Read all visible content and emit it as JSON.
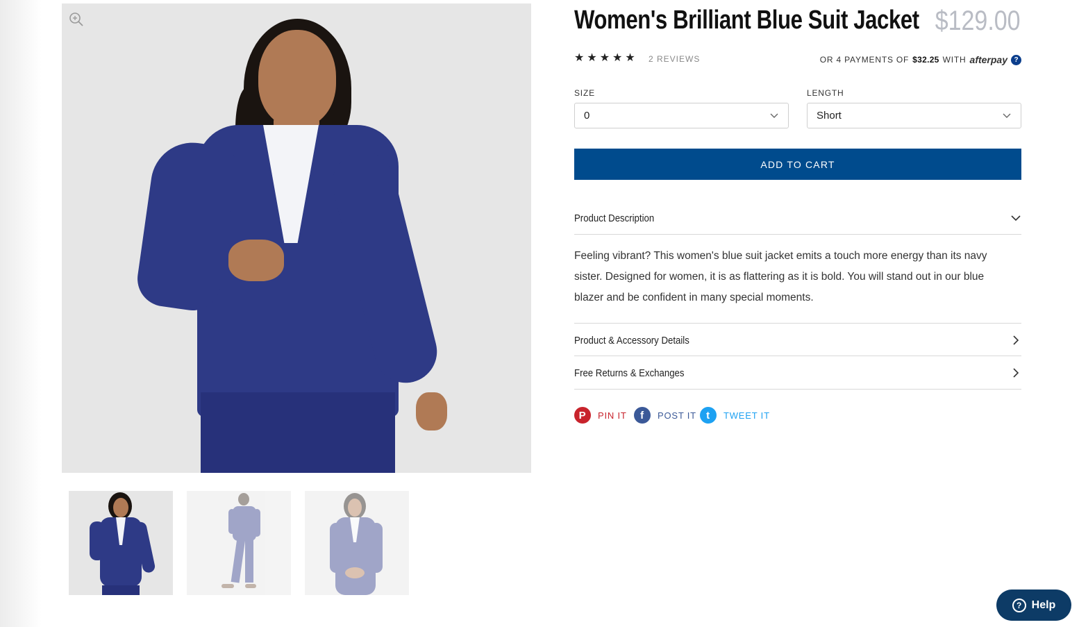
{
  "product": {
    "title": "Women's Brilliant Blue Suit Jacket",
    "price": "$129.00",
    "rating": 5,
    "reviews_label": "2 REVIEWS"
  },
  "afterpay": {
    "prefix": "OR 4 PAYMENTS OF",
    "amount": "$32.25",
    "with": "WITH",
    "logo": "afterpay",
    "help": "?"
  },
  "options": {
    "size_label": "SIZE",
    "size_value": "0",
    "length_label": "LENGTH",
    "length_value": "Short"
  },
  "cart": {
    "add_label": "ADD TO CART"
  },
  "accordion": {
    "description_title": "Product Description",
    "description_text": "Feeling vibrant? This women's blue suit jacket emits a touch more energy than its navy sister. Designed for women, it is as flattering as it is bold. You will stand out in our blue blazer and be confident in many special moments.",
    "details_title": "Product & Accessory Details",
    "returns_title": "Free Returns & Exchanges"
  },
  "share": {
    "pin": "PIN IT",
    "post": "POST IT",
    "tweet": "TWEET IT"
  },
  "help_widget": {
    "label": "Help"
  },
  "colors": {
    "brand_blue": "#004b8d",
    "pinterest": "#c8232c",
    "facebook": "#3b5998",
    "twitter": "#1da1f2",
    "price_gray": "#b9bcc4"
  },
  "icons": [
    "zoom-in-icon",
    "star-icon",
    "chevron-down-icon",
    "chevron-right-icon",
    "pinterest-icon",
    "facebook-icon",
    "twitter-icon",
    "help-icon"
  ]
}
